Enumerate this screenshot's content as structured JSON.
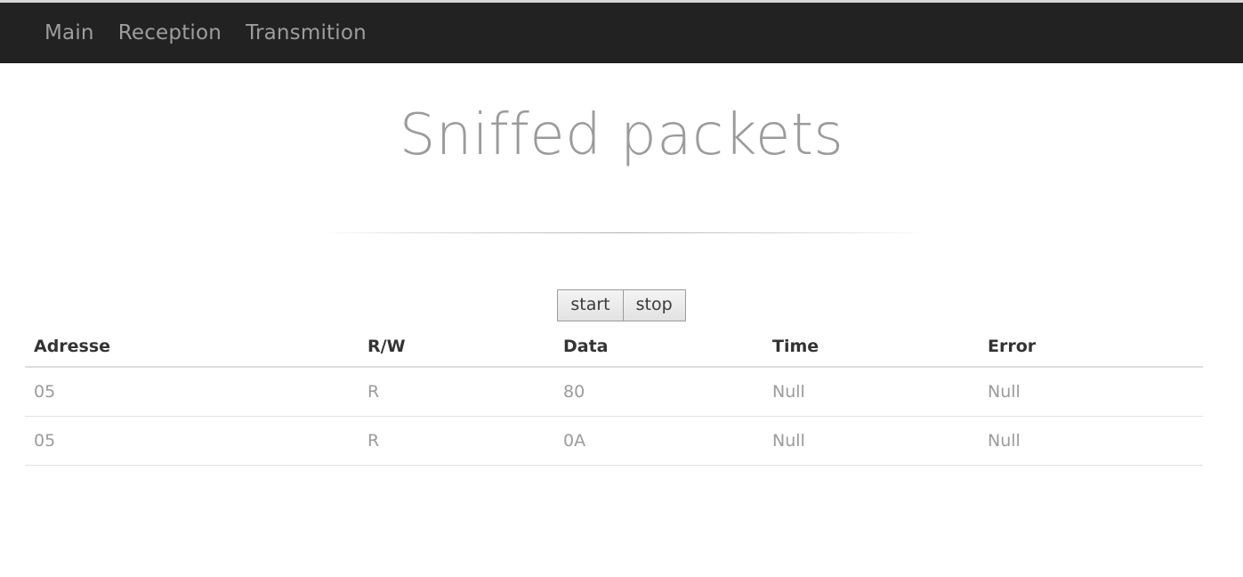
{
  "navbar": {
    "links": [
      {
        "label": "Main"
      },
      {
        "label": "Reception"
      },
      {
        "label": "Transmition"
      }
    ]
  },
  "main": {
    "title": "Sniffed packets",
    "controls": {
      "start_label": "start",
      "stop_label": "stop"
    },
    "table": {
      "columns": [
        "Adresse",
        "R/W",
        "Data",
        "Time",
        "Error"
      ],
      "rows": [
        {
          "adresse": "05",
          "rw": "R",
          "data": "80",
          "time": "Null",
          "error": "Null"
        },
        {
          "adresse": "05",
          "rw": "R",
          "data": "0A",
          "time": "Null",
          "error": "Null"
        }
      ]
    }
  },
  "theme": {
    "navbar_background": "#222222",
    "navbar_link_color": "#9d9d9d",
    "title_color": "#9b9b9b",
    "table_header_color": "#333333",
    "table_cell_color": "#9b9b9b",
    "table_border_color": "#dddddd",
    "page_background": "#ffffff"
  }
}
